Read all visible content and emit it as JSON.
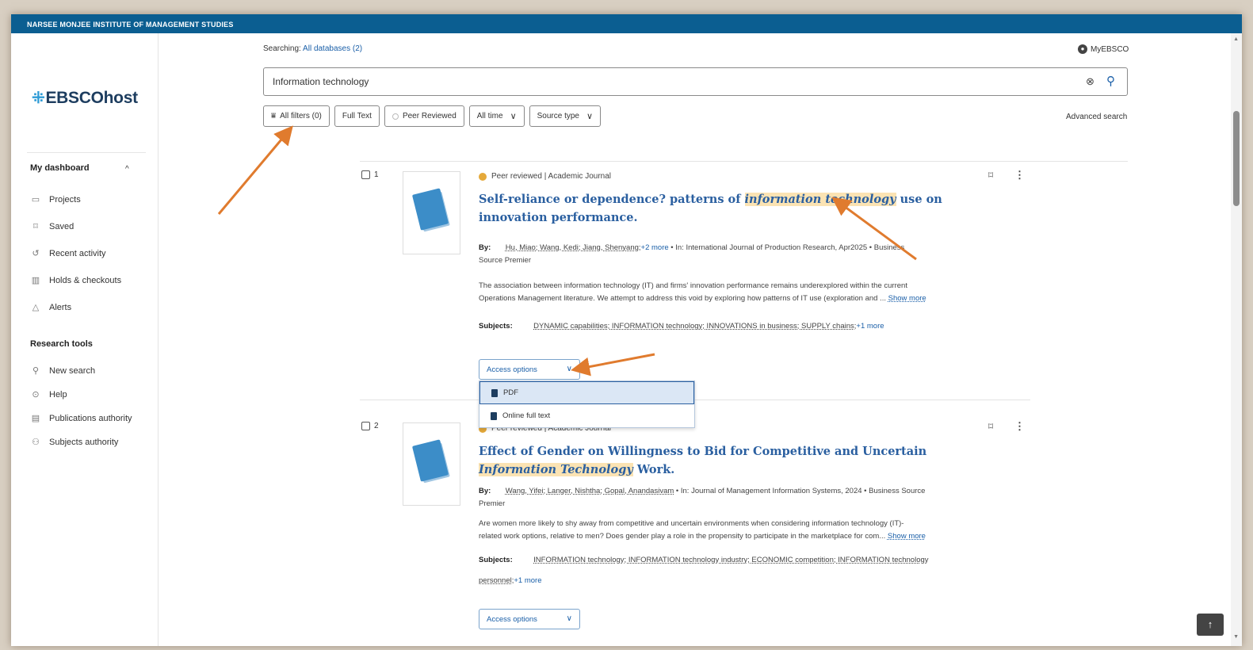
{
  "topbar": {
    "institution": "NARSEE MONJEE INSTITUTE OF MANAGEMENT STUDIES"
  },
  "logo": {
    "mark": "⁜",
    "text": "EBSCOhost"
  },
  "sidebar": {
    "dashboard_heading": "My dashboard",
    "dashboard_items": [
      {
        "label": "Projects",
        "icon": "folder-icon"
      },
      {
        "label": "Saved",
        "icon": "bookmark-icon"
      },
      {
        "label": "Recent activity",
        "icon": "history-icon"
      },
      {
        "label": "Holds & checkouts",
        "icon": "library-icon"
      },
      {
        "label": "Alerts",
        "icon": "bell-icon"
      }
    ],
    "research_heading": "Research tools",
    "research_items": [
      {
        "label": "New search",
        "icon": "search-icon"
      },
      {
        "label": "Help",
        "icon": "help-icon"
      },
      {
        "label": "Publications authority",
        "icon": "publication-icon"
      },
      {
        "label": "Subjects authority",
        "icon": "hierarchy-icon"
      }
    ]
  },
  "search": {
    "searching_label": "Searching:",
    "databases_link": "All databases (2)",
    "myebsco": "MyEBSCO",
    "query": "Information technology",
    "advanced": "Advanced search",
    "filters": {
      "all_filters": "All filters (0)",
      "full_text": "Full Text",
      "peer_reviewed": "Peer Reviewed",
      "all_time": "All time",
      "source_type": "Source type"
    }
  },
  "results": [
    {
      "number": "1",
      "meta": "Peer reviewed | Academic Journal",
      "title_pre": "Self-reliance or dependence? patterns of ",
      "title_hl": "information technology",
      "title_post": " use on innovation performance.",
      "by_label": "By:",
      "authors": "Hu, Miao; Wang, Kedi; Jiang, Shenyang;",
      "authors_more": "+2 more",
      "source_line_1": " • In: International Journal of Production Research, Apr2025 • Business",
      "source_line_2": "Source Premier",
      "abstract_1": "The association between information technology (IT) and firms' innovation performance remains underexplored within the current",
      "abstract_2": "Operations Management literature. We attempt to address this void by exploring how patterns of IT use (exploration and ...",
      "show_more": "Show more",
      "subjects_label": "Subjects:",
      "subjects": "DYNAMIC capabilities; INFORMATION technology; INNOVATIONS in business; SUPPLY chains;",
      "subjects_more": "+1 more",
      "access": "Access options"
    },
    {
      "number": "2",
      "meta": "Peer reviewed | Academic Journal",
      "title_pre": "Effect of Gender on Willingness to Bid for Competitive and Uncertain ",
      "title_hl": "Information Technology",
      "title_post": " Work.",
      "by_label": "By:",
      "authors": "Wang, Yifei; Langer, Nishtha; Gopal, Anandasivam",
      "source_line_1": " • In: Journal of Management Information Systems, 2024 • Business Source",
      "source_line_2": "Premier",
      "abstract_1": "Are women more likely to shy away from competitive and uncertain environments when considering information technology (IT)-",
      "abstract_2": "related work options, relative to men? Does gender play a role in the propensity to participate in the marketplace for com...",
      "show_more": "Show more",
      "subjects_label": "Subjects:",
      "subjects": "INFORMATION technology; INFORMATION technology industry; ECONOMIC competition; INFORMATION technology",
      "subjects_2": "personnel;",
      "subjects_more": "+1 more",
      "access": "Access options"
    }
  ],
  "access_menu": {
    "items": [
      "PDF",
      "Online full text"
    ]
  },
  "back_to_top": "↑",
  "colors": {
    "topbar": "#0b5e91",
    "link": "#1a5fa8",
    "annotation_arrow": "#e07b2e",
    "highlight": "#fbe3b3"
  }
}
